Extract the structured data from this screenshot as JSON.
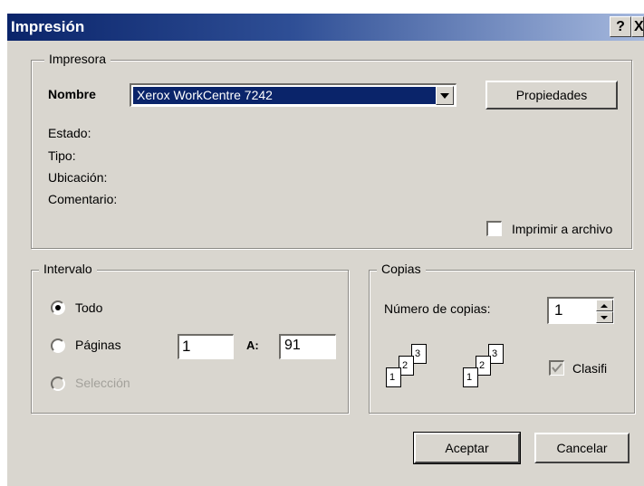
{
  "window": {
    "title": "Impresión",
    "help_button": "?",
    "close_button": "X"
  },
  "printer": {
    "group_label": "Impresora",
    "name_label": "Nombre",
    "selected_printer": "Xerox WorkCentre 7242",
    "properties_button": "Propiedades",
    "status_label": "Estado:",
    "type_label": "Tipo:",
    "location_label": "Ubicación:",
    "comment_label": "Comentario:",
    "print_to_file_label": "Imprimir a archivo",
    "print_to_file_checked": false
  },
  "range": {
    "group_label": "Intervalo",
    "all_label": "Todo",
    "pages_label": "Páginas",
    "selection_label": "Selección",
    "selected": "all",
    "from_value": "1",
    "to_label": "A:",
    "to_value": "91"
  },
  "copies": {
    "group_label": "Copias",
    "count_label": "Número de copias:",
    "count_value": "1",
    "collate_label": "Clasifi",
    "collate_checked": true,
    "collate_page_numbers": [
      "1",
      "2",
      "3"
    ]
  },
  "actions": {
    "ok_button": "Aceptar",
    "cancel_button": "Cancelar"
  },
  "colors": {
    "title_gradient_start": "#0a246a",
    "dialog_bg": "#d9d6cf",
    "selection_bg": "#0a246a"
  }
}
